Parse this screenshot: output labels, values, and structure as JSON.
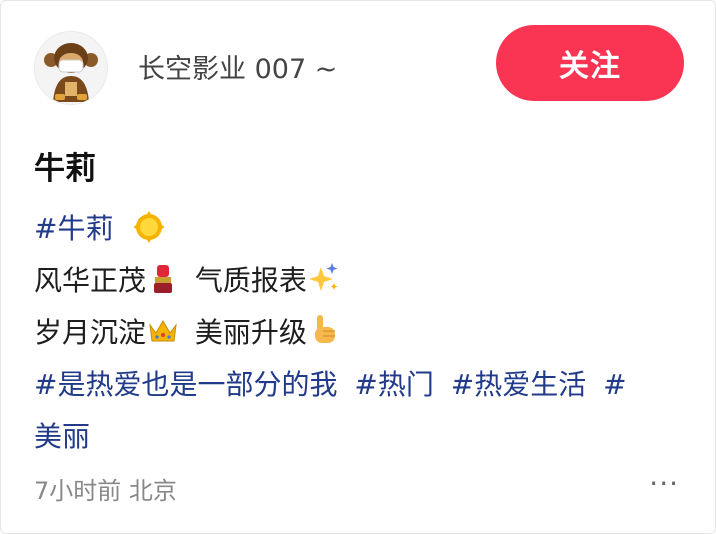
{
  "header": {
    "username": "长空影业 007 ~",
    "follow_label": "关注"
  },
  "post": {
    "title": "牛莉",
    "lines": [
      {
        "tag": "#牛莉",
        "emoji": "sun-emoji"
      },
      {
        "text": "风华正茂",
        "emoji1": "lipstick-emoji",
        "text2": "气质报表",
        "emoji2": "sparkles-emoji"
      },
      {
        "text": "岁月沉淀",
        "emoji1": "crown-emoji",
        "text2": "美丽升级",
        "emoji2": "pointing-hand-emoji"
      }
    ],
    "tags": [
      "#是热爱也是一部分的我",
      "#热门",
      "#热爱生活",
      "#",
      "美丽"
    ]
  },
  "footer": {
    "meta": "7小时前 北京",
    "more_label": "···"
  },
  "colors": {
    "follow_button": "#fa3553",
    "tag": "#213a8a"
  }
}
